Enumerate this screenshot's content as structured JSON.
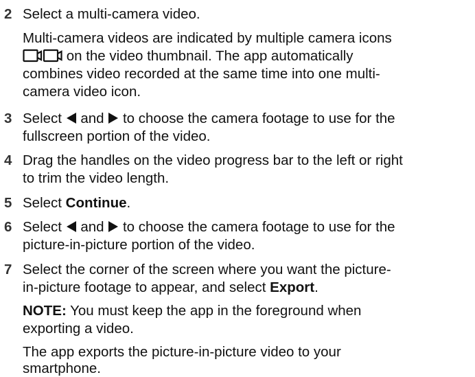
{
  "steps": [
    {
      "number": "2",
      "lines": [
        "Select a multi-camera video."
      ],
      "body": {
        "line1": "Multi-camera videos are indicated by multiple camera icons",
        "line2_rest": " on the video thumbnail. The app automatically",
        "line3": "combines video recorded at the same time into one multi-",
        "line4": "camera video icon."
      }
    },
    {
      "number": "3",
      "line1_a": "Select ",
      "line1_b": " and ",
      "line1_c": " to choose the camera footage to use for the",
      "line2": "fullscreen portion of the video."
    },
    {
      "number": "4",
      "line1": "Drag the handles on the video progress bar to the left or right",
      "line2": "to trim the video length."
    },
    {
      "number": "5",
      "prefix": "Select ",
      "bold": "Continue",
      "suffix": "."
    },
    {
      "number": "6",
      "line1_a": "Select ",
      "line1_b": " and ",
      "line1_c": " to choose the camera footage to use for the",
      "line2": "picture-in-picture portion of the video."
    },
    {
      "number": "7",
      "line1": "Select the corner of the screen where you want the picture-",
      "line2_a": "in-picture footage to appear, and select ",
      "line2_bold": "Export",
      "line2_c": ".",
      "note_label": "NOTE:",
      "note_line1": " You must keep the app in the foreground when",
      "note_line2": "exporting a video.",
      "final_line1": "The app exports the picture-in-picture video to your",
      "final_line2": "smartphone."
    }
  ],
  "icons": {
    "camera": "camera-icon",
    "left": "left-triangle-icon",
    "right": "right-triangle-icon"
  }
}
